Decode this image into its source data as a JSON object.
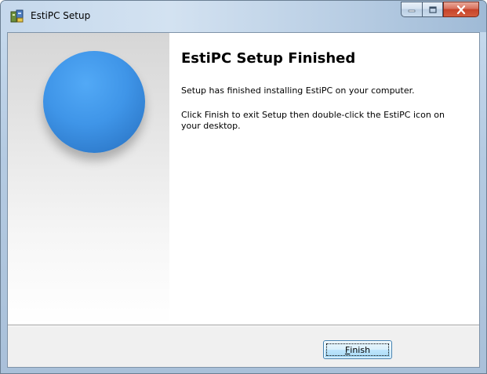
{
  "window": {
    "title": "EstiPC Setup",
    "icon": "installer-icon",
    "caption_buttons": {
      "minimize_icon": "minimize-icon",
      "maximize_icon": "maximize-icon",
      "close_icon": "close-icon"
    }
  },
  "side_panel": {
    "image": "blue-sphere-logo"
  },
  "content": {
    "heading": "EstiPC Setup Finished",
    "paragraph_1": "Setup has finished installing EstiPC on your computer.",
    "paragraph_2": "Click Finish to exit Setup then double-click the EstiPC icon on your desktop."
  },
  "footer": {
    "finish_mnemonic": "F",
    "finish_rest": "inish"
  },
  "colors": {
    "sphere_blue": "#3f95e8",
    "button_border": "#3c7fb1",
    "close_red": "#c7432a"
  }
}
